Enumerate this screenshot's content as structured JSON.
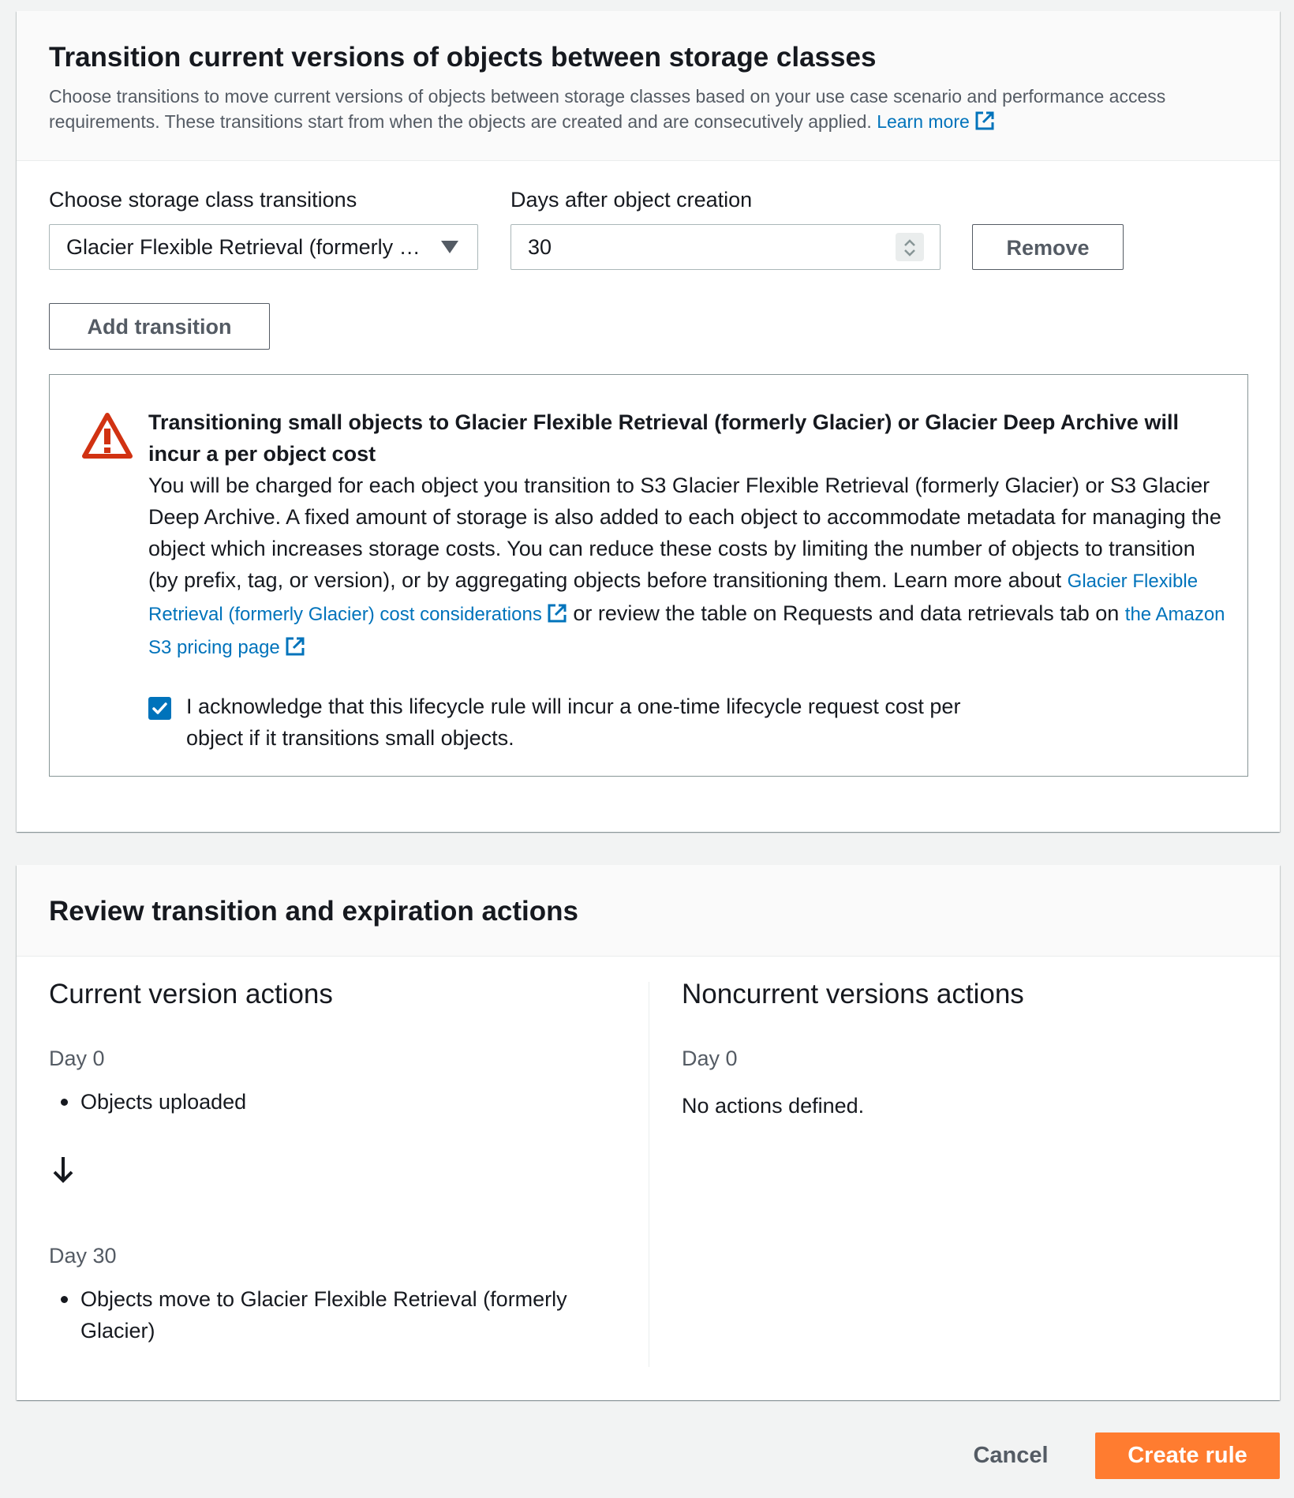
{
  "transition_panel": {
    "title": "Transition current versions of objects between storage classes",
    "description": "Choose transitions to move current versions of objects between storage classes based on your use case scenario and performance access requirements. These transitions start from when the objects are created and are consecutively applied.",
    "learn_more": "Learn more",
    "storage_class_label": "Choose storage class transitions",
    "storage_class_value": "Glacier Flexible Retrieval (formerly Glacier)",
    "days_label": "Days after object creation",
    "days_value": "30",
    "remove_button": "Remove",
    "add_transition_button": "Add transition"
  },
  "alert": {
    "title": "Transitioning small objects to Glacier Flexible Retrieval (formerly Glacier) or Glacier Deep Archive will incur a per object cost",
    "body": "You will be charged for each object you transition to S3 Glacier Flexible Retrieval (formerly Glacier) or S3 Glacier Deep Archive. A fixed amount of storage is also added to each object to accommodate metadata for managing the object which increases storage costs. You can reduce these costs by limiting the number of objects to transition (by prefix, tag, or version), or by aggregating objects before transitioning them.",
    "learn_more_prefix": "Learn more about",
    "cost_link": "Glacier Flexible Retrieval (formerly Glacier) cost considerations",
    "middle_text": "or review the table on Requests and data retrievals tab on",
    "pricing_link": "the Amazon S3 pricing page",
    "ack_checked": true,
    "ack_text": "I acknowledge that this lifecycle rule will incur a one-time lifecycle request cost per object if it transitions small objects."
  },
  "review_panel": {
    "title": "Review transition and expiration actions",
    "current": {
      "heading": "Current version actions",
      "day0_label": "Day 0",
      "day0_item": "Objects uploaded",
      "day30_label": "Day 30",
      "day30_item": "Objects move to Glacier Flexible Retrieval (formerly Glacier)"
    },
    "noncurrent": {
      "heading": "Noncurrent versions actions",
      "day0_label": "Day 0",
      "empty_text": "No actions defined."
    }
  },
  "footer": {
    "cancel": "Cancel",
    "create_rule": "Create rule"
  },
  "colors": {
    "link": "#0073bb",
    "primary_button": "#ff7c30",
    "warning": "#d13212",
    "checkbox": "#0073bb"
  },
  "icons": [
    "external-link-icon",
    "caret-down-icon",
    "stepper-icon",
    "warning-icon",
    "checkmark-icon",
    "arrow-down-icon"
  ]
}
